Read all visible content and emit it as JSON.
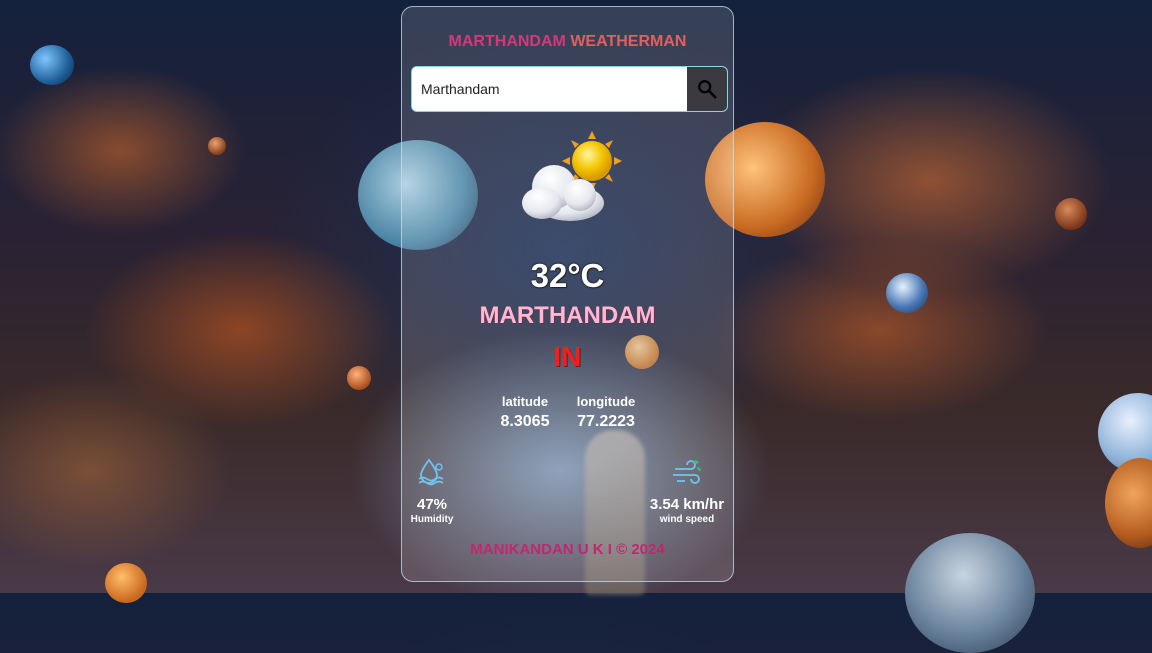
{
  "app": {
    "title_part1": "MARTHANDAM ",
    "title_part2": "WEATHERMAN"
  },
  "search": {
    "value": "Marthandam",
    "placeholder": "",
    "button_icon": "search-icon"
  },
  "weather": {
    "icon": "partly-cloudy-icon",
    "temperature": "32°C",
    "city": "MARTHANDAM",
    "country": "IN"
  },
  "coordinates": {
    "latitude_label": "latitude",
    "latitude_value": "8.3065",
    "longitude_label": "longitude",
    "longitude_value": "77.2223"
  },
  "metrics": {
    "humidity_icon": "humidity-icon",
    "humidity_value": "47%",
    "humidity_label": "Humidity",
    "wind_icon": "wind-icon",
    "wind_value": "3.54 km/hr",
    "wind_label": "wind speed"
  },
  "footer": {
    "text": "MANIKANDAN U K I © 2024"
  },
  "colors": {
    "title": "#d13a7a",
    "city": "#ffb8d0",
    "country": "#ff1a1a",
    "footer": "#c4256f",
    "search_border": "#7fd8e6",
    "search_button": "#3a3a40"
  }
}
